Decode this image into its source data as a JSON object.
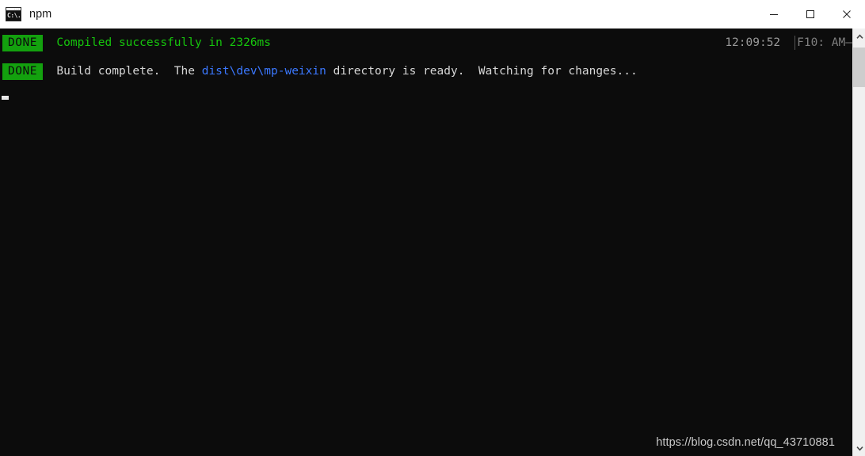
{
  "window": {
    "title": "npm",
    "icon_name": "console-icon",
    "icon_text": "C:\\.",
    "controls": {
      "minimize_label": "Minimize",
      "maximize_label": "Maximize",
      "close_label": "Close"
    }
  },
  "terminal": {
    "lines": [
      {
        "badge": "DONE",
        "segments": [
          {
            "text": "  Compiled successfully in 2326ms",
            "color": "green"
          }
        ],
        "right": {
          "clock": "12:09:52",
          "hint": "F10: AM–"
        }
      },
      {
        "badge": "DONE",
        "segments": [
          {
            "text": "  Build complete.  The ",
            "color": "white"
          },
          {
            "text": "dist\\dev\\mp-weixin",
            "color": "blue"
          },
          {
            "text": " directory is ready.  Watching for changes...",
            "color": "white"
          }
        ]
      }
    ],
    "cursor": "▃"
  },
  "watermark": {
    "url": "https://blog.csdn.net/qq_43710881"
  },
  "scrollbar": {
    "up_arrow": "˄",
    "down_arrow": "˅"
  },
  "colors": {
    "terminal_background": "#0c0c0c",
    "badge_background": "#13a10e",
    "badge_text": "#0c0c0c",
    "success_green": "#16c60c",
    "path_blue": "#3b78ff",
    "body_text": "#d6d6d6",
    "clock_gray": "#9a9a9a",
    "titlebar_background": "#ffffff"
  }
}
